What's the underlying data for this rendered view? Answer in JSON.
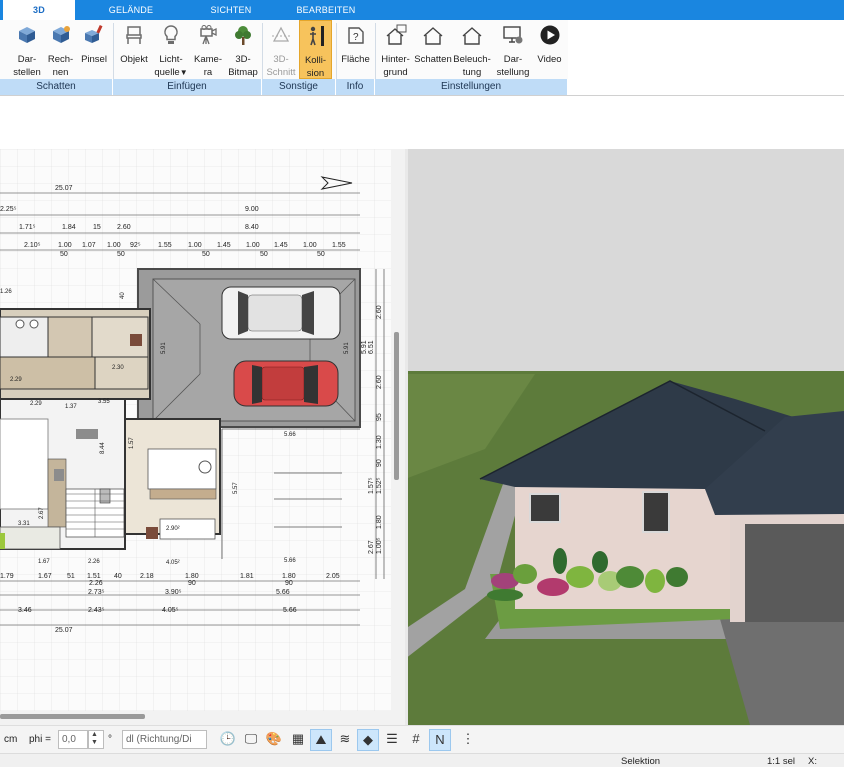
{
  "tabs": [
    {
      "label": "3D",
      "active": true
    },
    {
      "label": "GELÄNDE",
      "active": false
    },
    {
      "label": "SICHTEN",
      "active": false
    },
    {
      "label": "BEARBEITEN",
      "active": false
    }
  ],
  "ribbon": {
    "buttons": [
      {
        "label": "Dar-\nstellen",
        "icon": "render-cube-icon"
      },
      {
        "label": "Rech-\nnen",
        "icon": "compute-cube-icon"
      },
      {
        "label": "Pinsel",
        "icon": "brush-cube-icon"
      },
      {
        "label": "Objekt",
        "icon": "chair-icon"
      },
      {
        "label": "Licht-\nquelle",
        "icon": "light-bulb-icon",
        "dropdown": "▼"
      },
      {
        "label": "Kame-\nra",
        "icon": "camera-icon"
      },
      {
        "label": "3D-\nBitmap",
        "icon": "tree-icon"
      },
      {
        "label": "3D-\nSchnitt",
        "icon": "cut-icon",
        "disabled": true
      },
      {
        "label": "Kolli-\nsion",
        "icon": "person-collision-icon",
        "selected": true
      },
      {
        "label": "Fläche",
        "icon": "area-info-icon"
      },
      {
        "label": "Hinter-\ngrund",
        "icon": "house-background-icon"
      },
      {
        "label": "Schatten",
        "icon": "house-shadow-icon"
      },
      {
        "label": "Beleuch-\ntung",
        "icon": "house-light-icon"
      },
      {
        "label": "Dar-\nstellung",
        "icon": "monitor-settings-icon"
      },
      {
        "label": "Video",
        "icon": "play-icon"
      }
    ],
    "groups": [
      "Schatten",
      "Einfügen",
      "Sonstige",
      "Info",
      "Einstellungen"
    ]
  },
  "plan": {
    "dims_top": [
      "25.07",
      "2.25⁵",
      "9.00",
      "1.71⁵",
      "1.84",
      "15",
      "2.60",
      "8.40",
      "2.10⁵",
      "1.00",
      "1.07",
      "1.00",
      "92⁵",
      "1.55",
      "1.00",
      "1.45",
      "1.00",
      "1.45",
      "1.00",
      "1.55",
      "50",
      "50",
      "50",
      "50",
      "50"
    ],
    "dims_bottom": [
      "1.79",
      "1.67",
      "51",
      "1.51",
      "40",
      "2.18",
      "1.80",
      "1.81",
      "1.80",
      "2.05",
      "2.26",
      "90",
      "90",
      "2.73⁵",
      "3.90⁵",
      "4.05⁵",
      "5.66",
      "3.46",
      "2.43⁵",
      "5.66",
      "25.07"
    ],
    "dims_right": [
      "2.60",
      "5.91",
      "2.60",
      "95",
      "1.30",
      "90",
      "1.52⁵",
      "1.80",
      "1.00⁵",
      "6.51",
      "1.57⁵",
      "2.67"
    ],
    "room_labels": [
      "5.91",
      "5.91",
      "5.66",
      "5.66",
      "5.57",
      "2.29",
      "2.30",
      "3.55",
      "3.31",
      "2.67",
      "1.67",
      "2.26",
      "2.90²",
      "4.05²",
      "8.44",
      "1.37",
      "1.57",
      "2.29",
      "1.26",
      "40"
    ]
  },
  "toolbar": {
    "unit": "cm",
    "phi_label": "phi =",
    "phi_value": "0,0",
    "degree": "°",
    "mode_value": "dl (Richtung/Di",
    "icons": [
      {
        "name": "clock-icon",
        "glyph": "🕒",
        "on": false
      },
      {
        "name": "presentation-icon",
        "glyph": "🖵",
        "on": false
      },
      {
        "name": "paint-icon",
        "glyph": "🎨",
        "on": false
      },
      {
        "name": "textures-icon",
        "glyph": "▦",
        "on": false
      },
      {
        "name": "terrain-icon",
        "glyph": "⛰",
        "on": true
      },
      {
        "name": "scribble-icon",
        "glyph": "≋",
        "on": false
      },
      {
        "name": "layer-icon",
        "glyph": "◆",
        "on": true
      },
      {
        "name": "stack-icon",
        "glyph": "☰",
        "on": false
      },
      {
        "name": "grid-icon",
        "glyph": "#",
        "on": false
      },
      {
        "name": "north-icon",
        "glyph": "N",
        "on": true
      },
      {
        "name": "more-icon",
        "glyph": "⋮",
        "on": false
      }
    ]
  },
  "status": {
    "mode": "Selektion",
    "scale": "1:1 sel",
    "coord": "X:"
  },
  "colors": {
    "accent": "#1a86e0",
    "ribbon_group": "#bfdcf7",
    "selected_button": "#f7c35c",
    "roof": "#2f3b4a",
    "lawn": "#5f7d3a",
    "wall": "#e7d6cf",
    "red_car": "#d43b3b"
  }
}
